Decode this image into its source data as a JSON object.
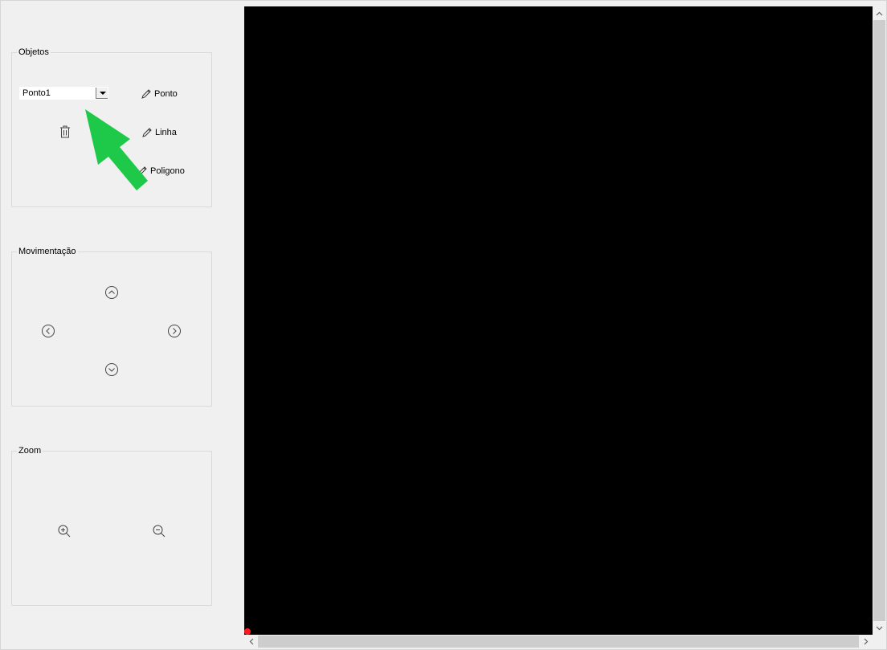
{
  "objetos": {
    "title": "Objetos",
    "select": {
      "value": "Ponto1"
    },
    "buttons": {
      "ponto": "Ponto",
      "linha": "Linha",
      "poligono": "Poligono"
    },
    "delete_icon": "trash-icon"
  },
  "movimentacao": {
    "title": "Movimentação",
    "icons": [
      "arrow-up-circle-icon",
      "arrow-left-circle-icon",
      "arrow-right-circle-icon",
      "arrow-down-circle-icon"
    ]
  },
  "zoom": {
    "title": "Zoom",
    "icons": [
      "zoom-in-icon",
      "zoom-out-icon"
    ]
  },
  "canvas": {
    "background": "#000000",
    "origin_color": "#ff1a1a"
  },
  "annotation": {
    "arrow_color": "#1ec94a"
  }
}
